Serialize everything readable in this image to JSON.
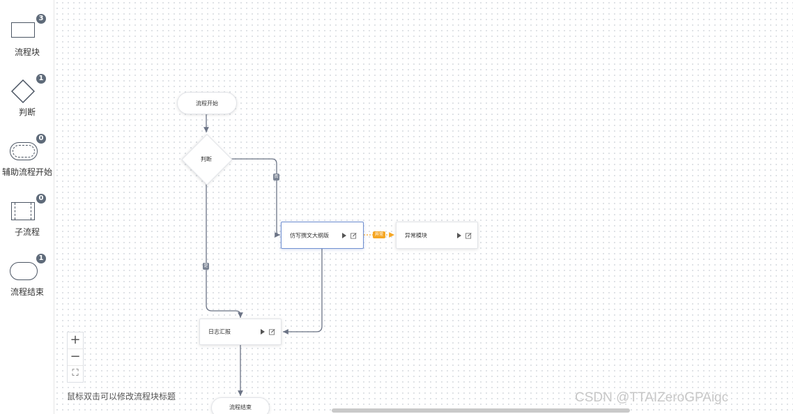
{
  "palette": [
    {
      "label": "流程块",
      "count": "3",
      "shape": "rectangle"
    },
    {
      "label": "判断",
      "count": "1",
      "shape": "diamond"
    },
    {
      "label": "辅助流程开始",
      "count": "0",
      "shape": "dashed-rounded"
    },
    {
      "label": "子流程",
      "count": "0",
      "shape": "subprocess"
    },
    {
      "label": "流程结束",
      "count": "1",
      "shape": "terminator"
    }
  ],
  "flow": {
    "start": "流程开始",
    "decision": "判断",
    "block1": "仿写撰文大纲版",
    "exception_block": "异常模块",
    "block2": "日志汇报",
    "end": "流程结束",
    "edge_tag_right": "否",
    "edge_tag_down": "是",
    "edge_tag_exception": "异常"
  },
  "zoom": {
    "in": "+",
    "out": "−",
    "fit": "⛶"
  },
  "hint": "鼠标双击可以修改流程块标题",
  "watermark": "CSDN @TTAIZeroGPAigc",
  "colors": {
    "badge": "#5f6b7a",
    "edge": "#6b7385",
    "exception": "#f5a623",
    "selected_border": "#6f8fd1"
  }
}
